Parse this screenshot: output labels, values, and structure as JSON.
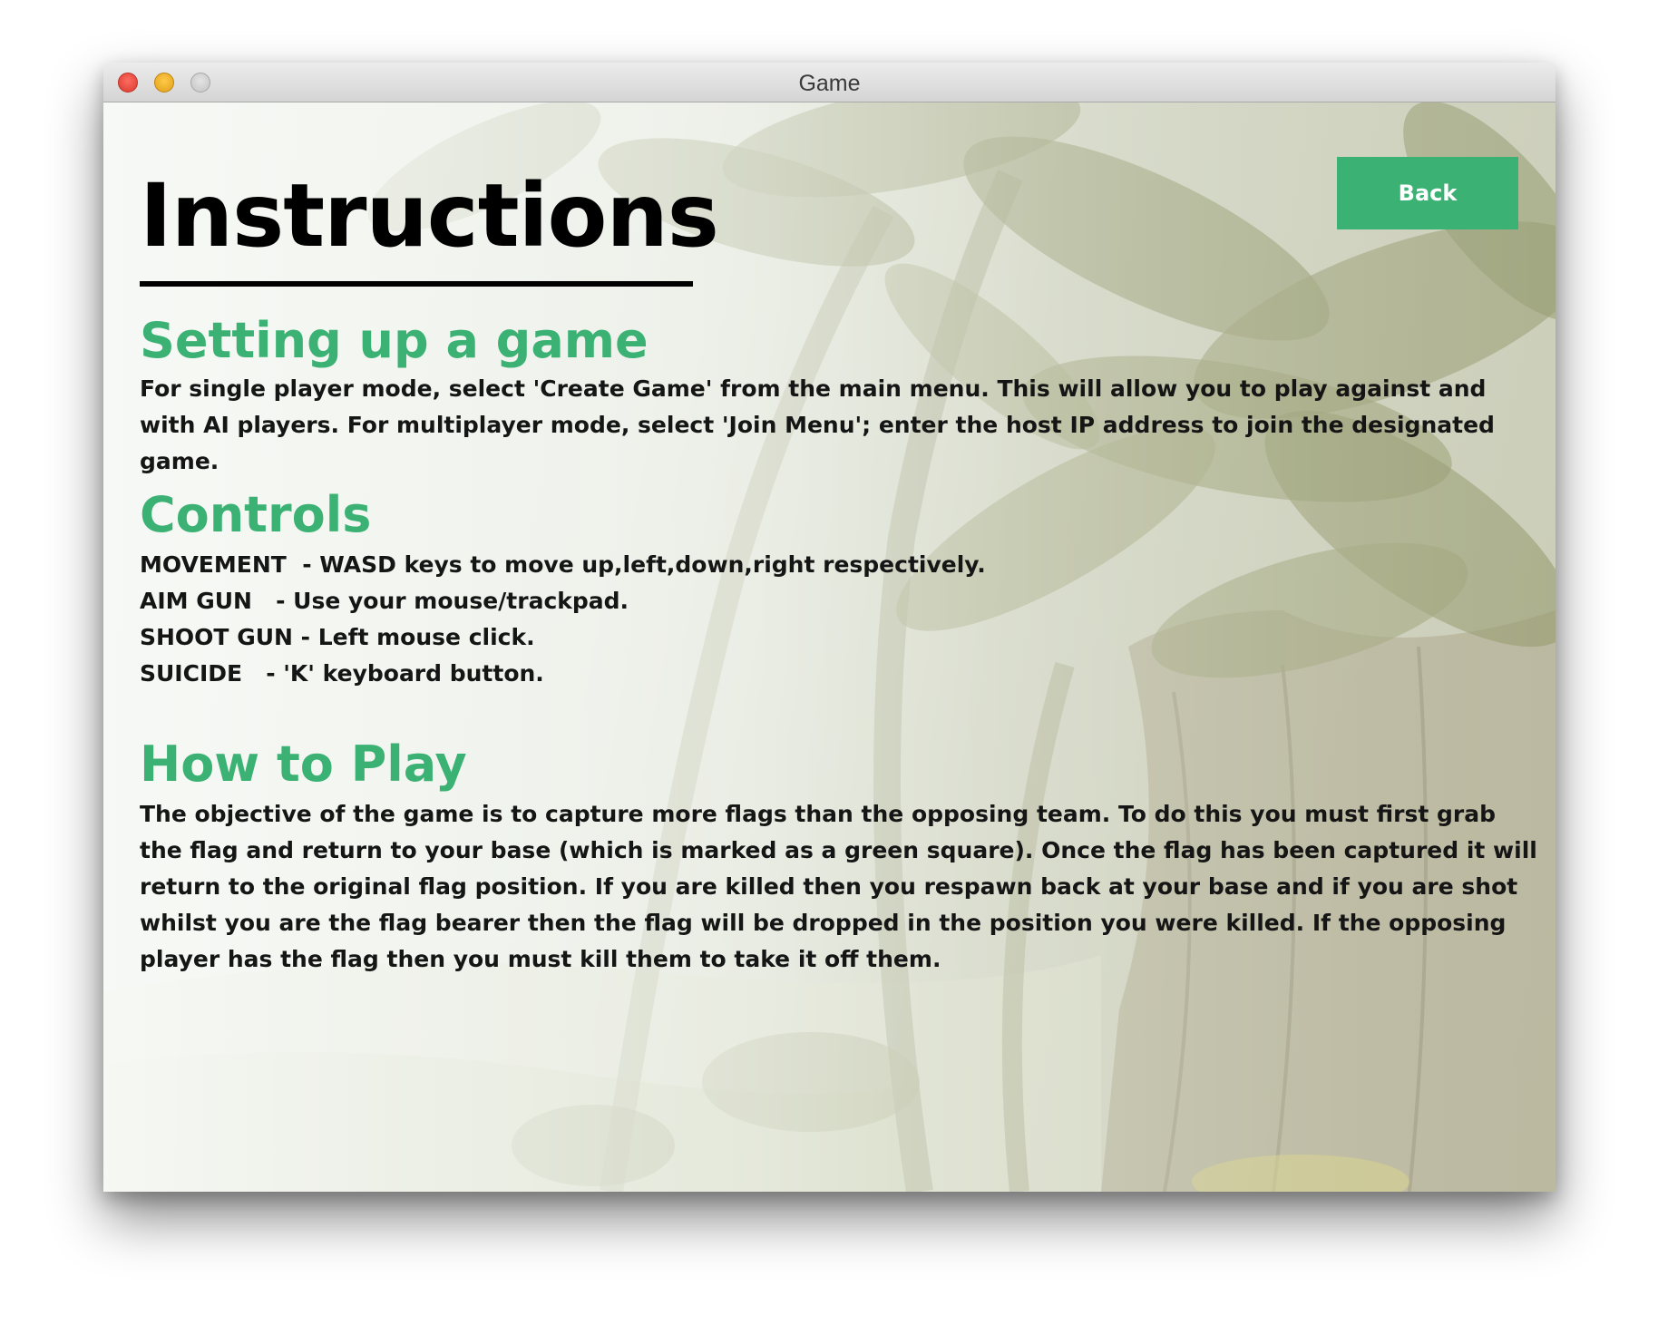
{
  "window": {
    "title": "Game"
  },
  "toolbar": {
    "back_label": "Back"
  },
  "page": {
    "heading": "Instructions"
  },
  "sections": {
    "setup": {
      "title": "Setting up a game",
      "body": "For single player mode, select 'Create Game' from the main menu. This will allow you to play against and with AI players. For multiplayer mode, select 'Join Menu'; enter the host IP address to join the designated game."
    },
    "controls": {
      "title": "Controls",
      "lines": [
        "MOVEMENT  - WASD keys to move up,left,down,right respectively.",
        "AIM GUN   - Use your mouse/trackpad.",
        "SHOOT GUN - Left mouse click.",
        "SUICIDE   - 'K' keyboard button."
      ]
    },
    "howto": {
      "title": "How to Play",
      "body": "The objective of the game is to capture more flags than the opposing team. To do this you must first grab the flag and return to your base (which is marked as a green square). Once the flag has been captured it will return to the original flag position. If you are killed then you respawn back at your base and if you are shot whilst you are the flag bearer then the flag will be dropped in the position you were killed. If the opposing player has the flag then you must kill them to take it off them."
    }
  },
  "colors": {
    "accent": "#3bb273",
    "heading": "#000000",
    "body_text": "#151515"
  },
  "icons": {
    "close": "close-icon",
    "minimize": "minimize-icon",
    "maximize": "maximize-icon"
  }
}
